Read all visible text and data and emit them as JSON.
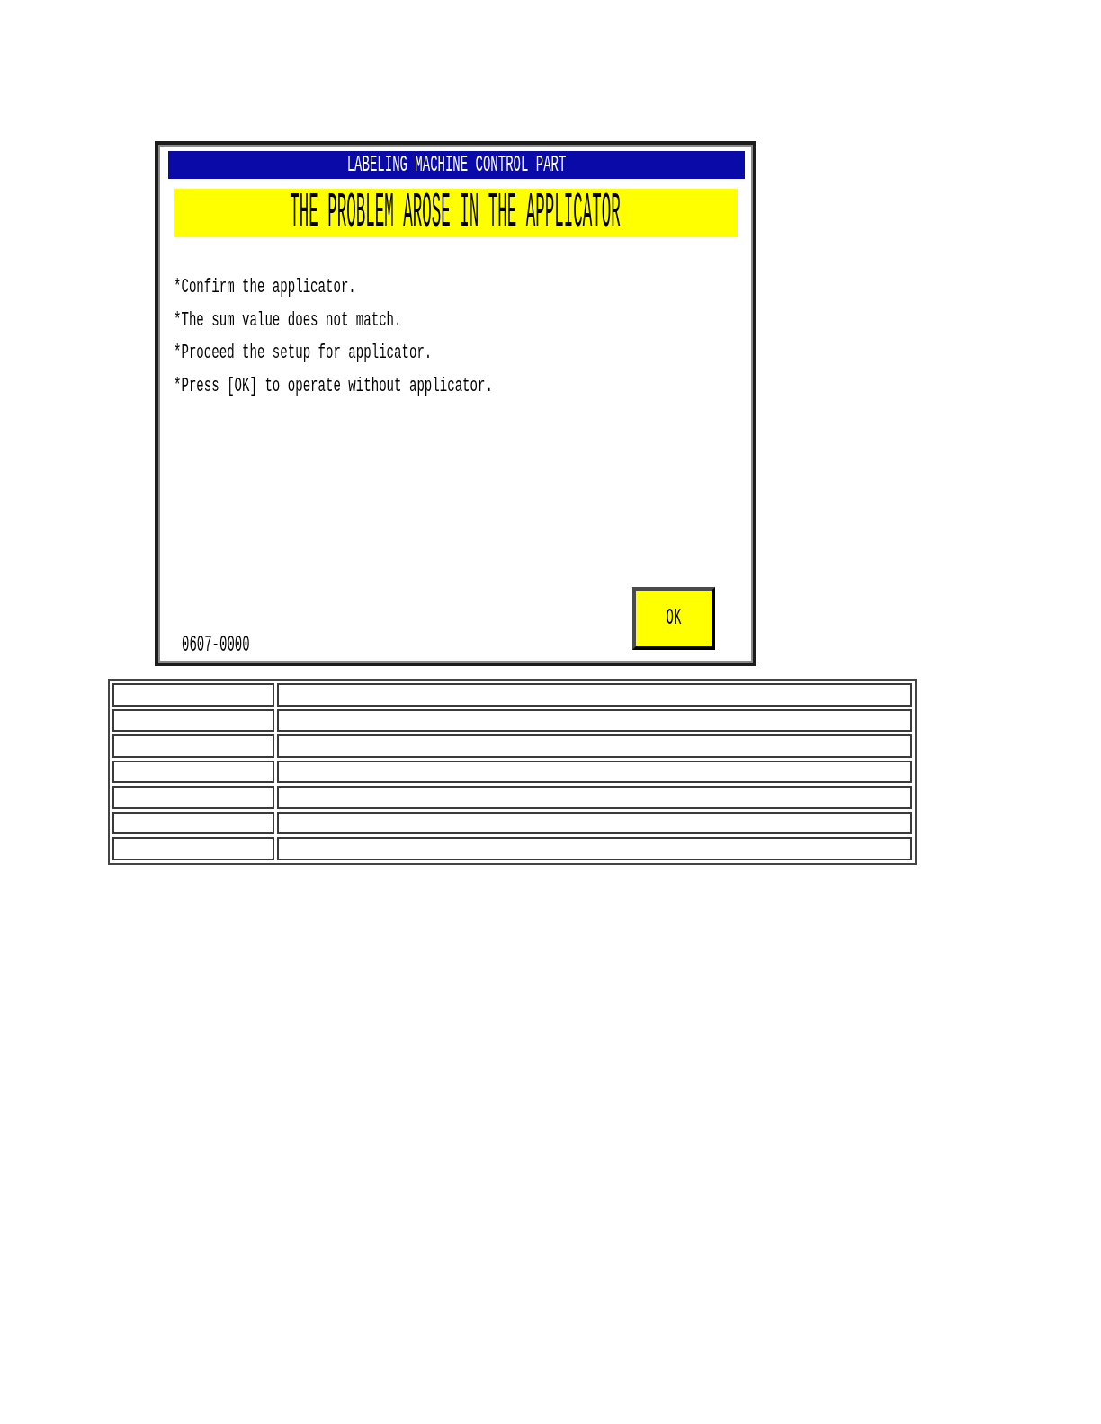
{
  "dialog": {
    "title": "LABELING MACHINE CONTROL PART",
    "heading": "THE PROBLEM AROSE IN THE APPLICATOR",
    "messages": [
      "*Confirm the applicator.",
      "*The sum value does not match.",
      "*Proceed the setup for applicator.",
      "*Press [OK] to operate without applicator."
    ],
    "code": "0607-0000",
    "buttons": [
      "OK"
    ]
  }
}
